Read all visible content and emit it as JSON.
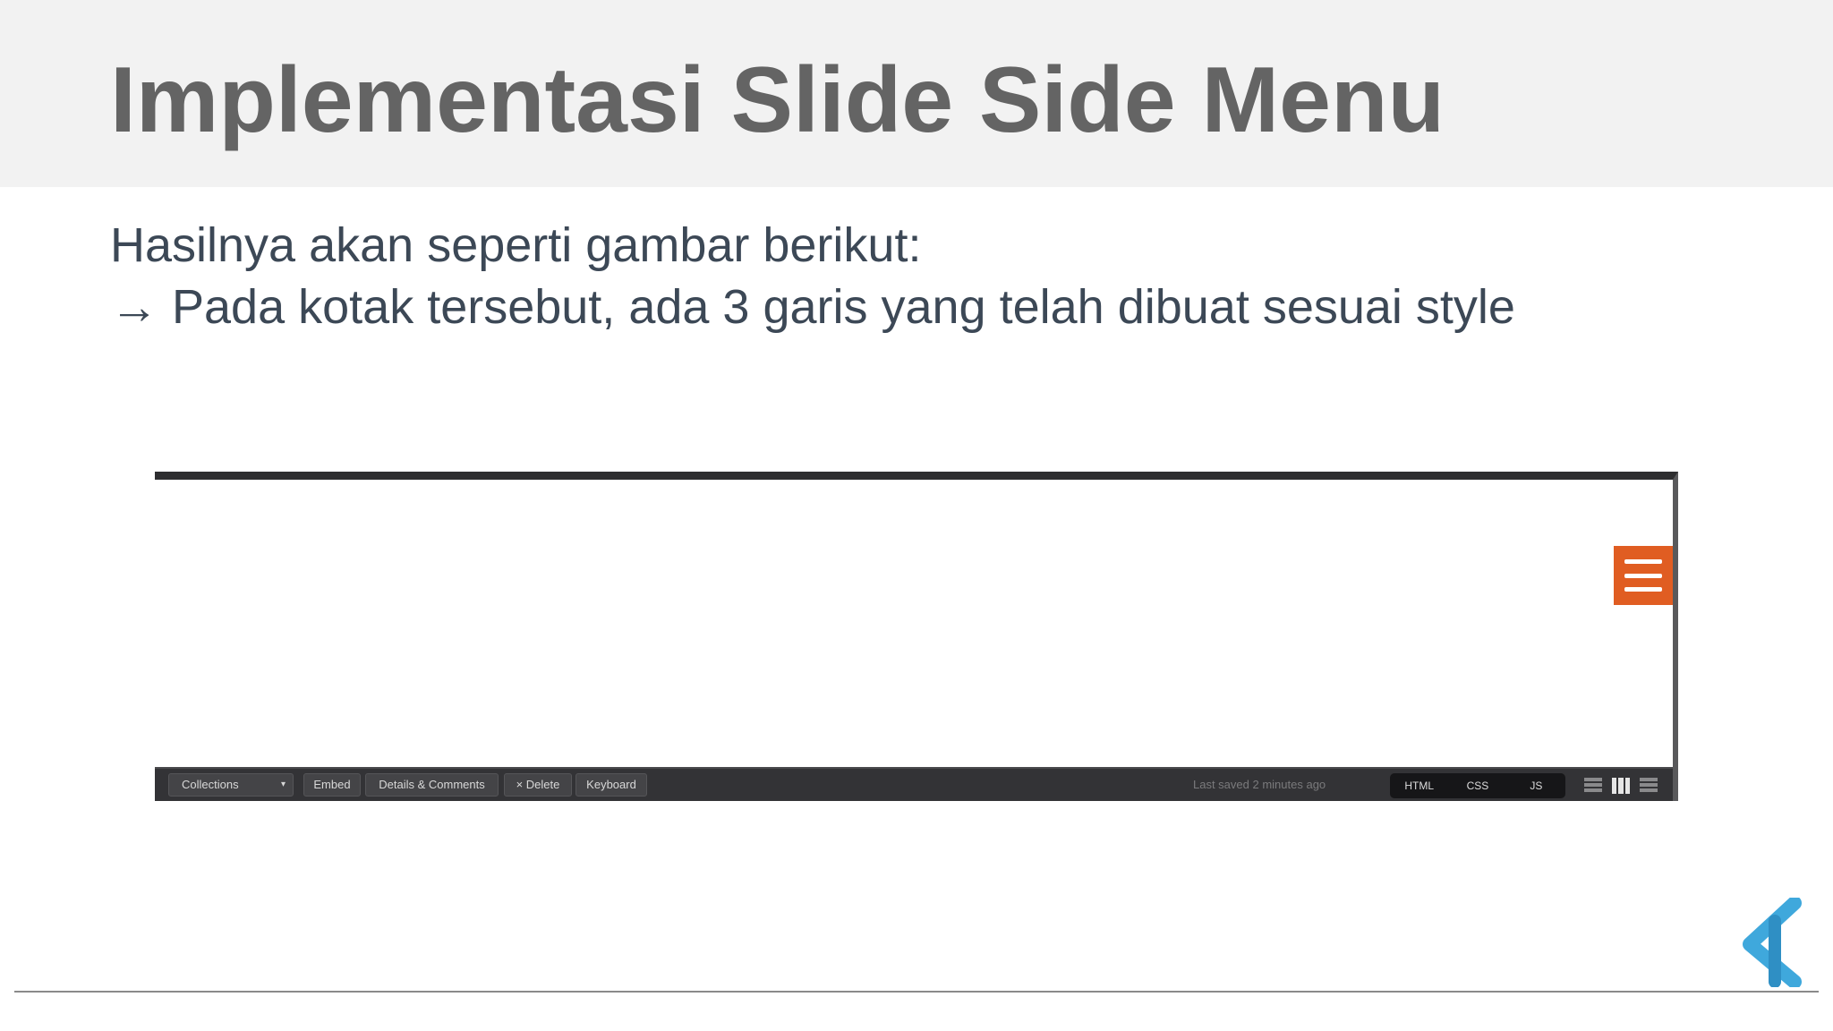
{
  "slide": {
    "title": "Implementasi Slide Side Menu",
    "body_lines": [
      "Hasilnya akan seperti gambar berikut:",
      "→ Pada kotak tersebut, ada 3 garis yang telah dibuat sesuai style"
    ]
  },
  "preview": {
    "menu_button_icon": "hamburger-icon",
    "menu_button_color": "#e05d22",
    "footer": {
      "collections_label": "Collections",
      "collections_caret": "▾",
      "embed_label": "Embed",
      "details_label": "Details & Comments",
      "delete_label": "× Delete",
      "keyboard_label": "Keyboard",
      "saved_status": "Last saved 2 minutes ago",
      "view_tabs": [
        "HTML",
        "CSS",
        "JS"
      ],
      "layout_icons": [
        "layout-left-icon",
        "layout-top-icon",
        "layout-right-icon"
      ]
    }
  },
  "logo": {
    "icon": "brand-logo-icon",
    "color": "#3fa8dc"
  }
}
